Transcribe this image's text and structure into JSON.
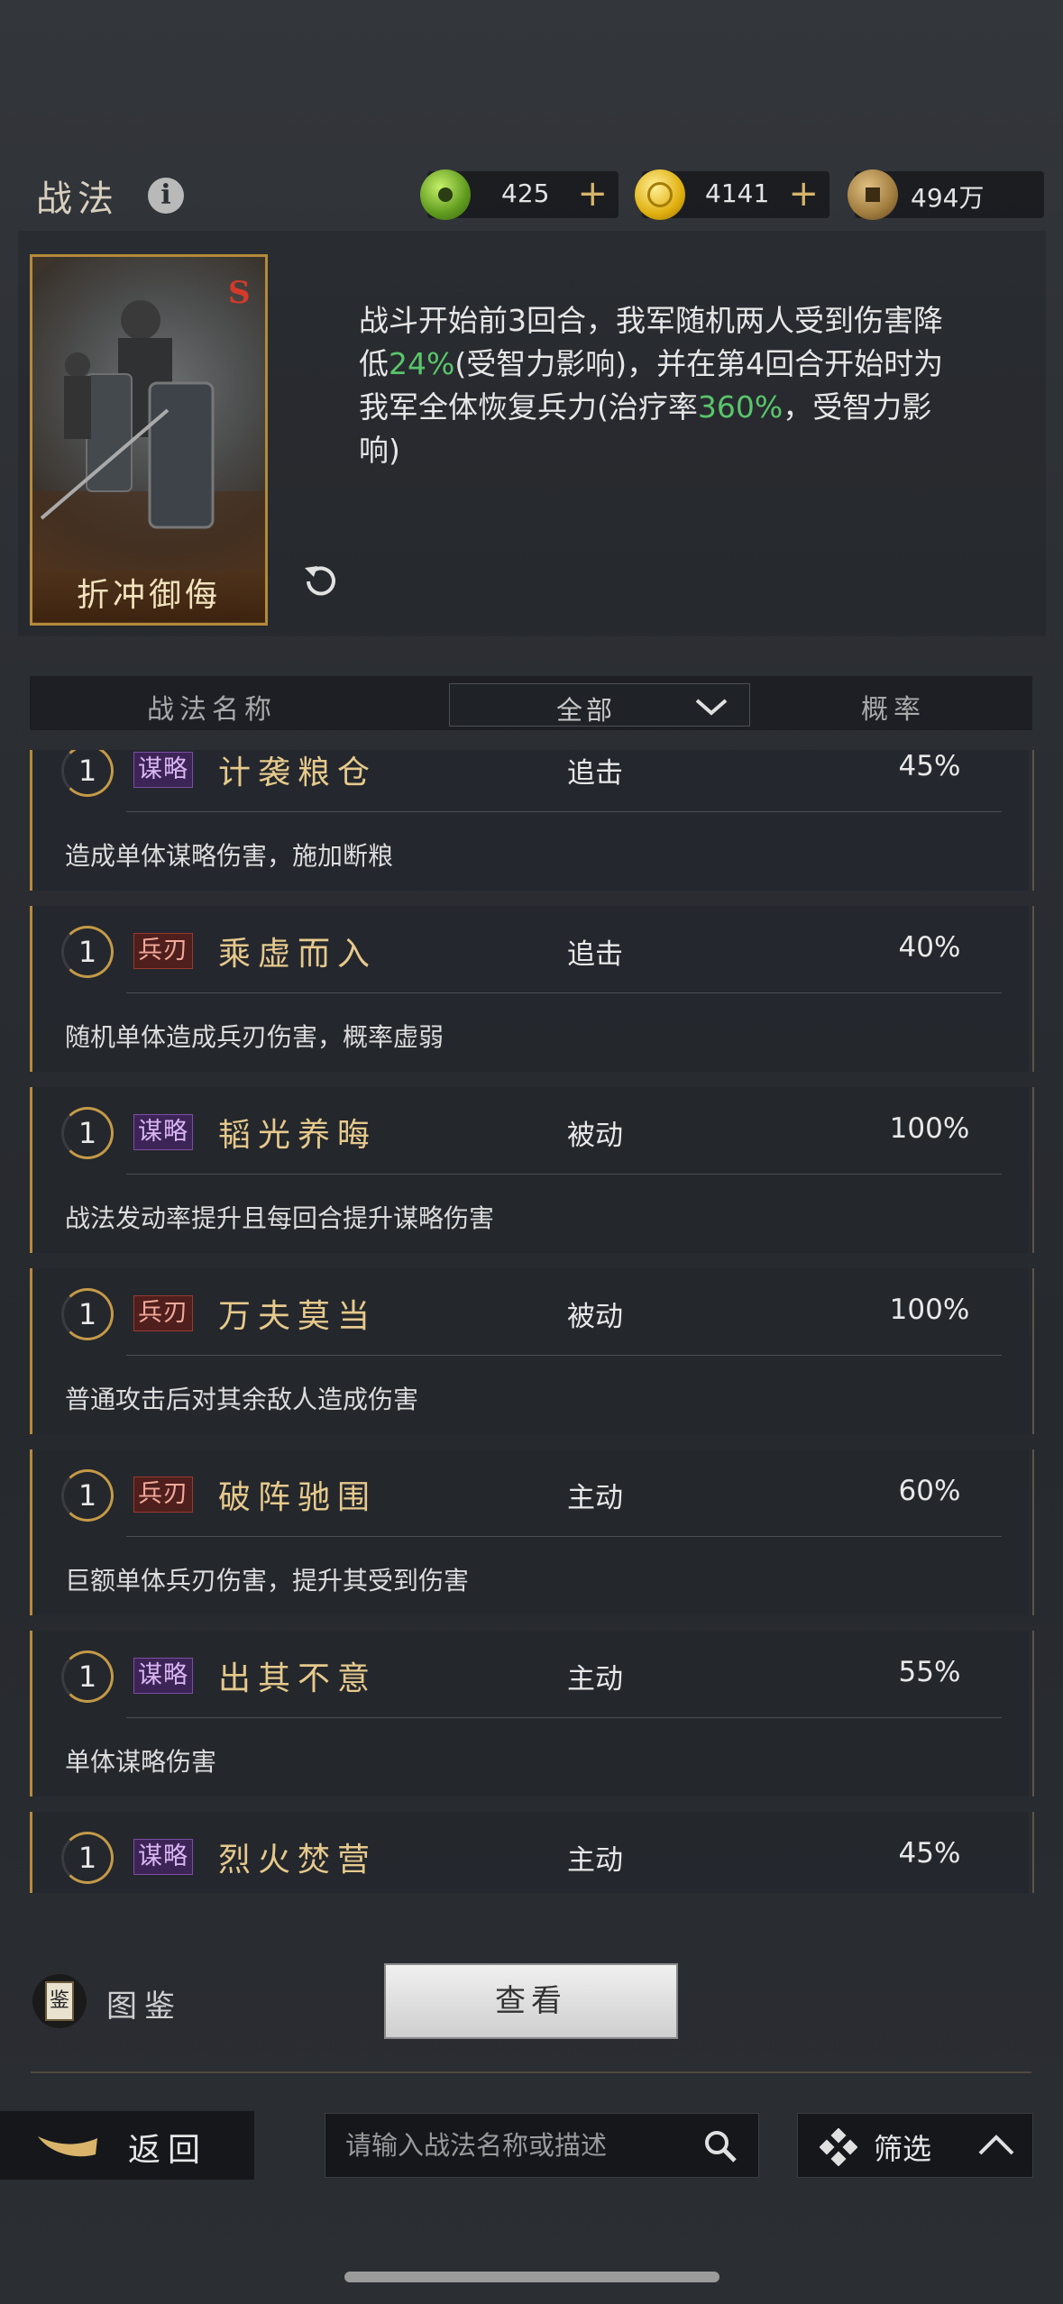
{
  "header": {
    "title": "战法",
    "info_icon": "info-icon",
    "resources": [
      {
        "name": "jade",
        "value": "425",
        "has_plus": true,
        "color": "#7dbf3a"
      },
      {
        "name": "gold",
        "value": "4141",
        "has_plus": true,
        "color": "#e2b520"
      },
      {
        "name": "copper",
        "value": "494万",
        "has_plus": false,
        "color": "#a8874a"
      }
    ]
  },
  "selected_skill": {
    "name": "折冲御侮",
    "badge": "S",
    "description": [
      {
        "t": "战斗开始前3回合，我军随机两人受到伤害降低"
      },
      {
        "t": "24%",
        "hl": true
      },
      {
        "t": "(受智力影响)，并在第4回合开始时为我军全体恢复兵力(治疗率"
      },
      {
        "t": "360%",
        "hl": true
      },
      {
        "t": "，受智力影响)"
      }
    ]
  },
  "table_header": {
    "name_col": "战法名称",
    "filter_value": "全部",
    "prob_col": "概率"
  },
  "skills": [
    {
      "level": "1",
      "tag": "谋略",
      "tag_kind": "mou",
      "name": "计袭粮仓",
      "type": "追击",
      "prob": "45%",
      "effect": "造成单体谋略伤害，施加断粮"
    },
    {
      "level": "1",
      "tag": "兵刃",
      "tag_kind": "bing",
      "name": "乘虚而入",
      "type": "追击",
      "prob": "40%",
      "effect": "随机单体造成兵刃伤害，概率虚弱"
    },
    {
      "level": "1",
      "tag": "谋略",
      "tag_kind": "mou",
      "name": "韬光养晦",
      "type": "被动",
      "prob": "100%",
      "effect": "战法发动率提升且每回合提升谋略伤害"
    },
    {
      "level": "1",
      "tag": "兵刃",
      "tag_kind": "bing",
      "name": "万夫莫当",
      "type": "被动",
      "prob": "100%",
      "effect": "普通攻击后对其余敌人造成伤害"
    },
    {
      "level": "1",
      "tag": "兵刃",
      "tag_kind": "bing",
      "name": "破阵驰围",
      "type": "主动",
      "prob": "60%",
      "effect": "巨额单体兵刃伤害，提升其受到伤害"
    },
    {
      "level": "1",
      "tag": "谋略",
      "tag_kind": "mou",
      "name": "出其不意",
      "type": "主动",
      "prob": "55%",
      "effect": "单体谋略伤害"
    },
    {
      "level": "1",
      "tag": "谋略",
      "tag_kind": "mou",
      "name": "烈火焚营",
      "type": "主动",
      "prob": "45%",
      "effect": ""
    }
  ],
  "bottom": {
    "codex_label": "图鉴",
    "codex_icon_text": "鉴",
    "view_label": "查看",
    "back_label": "返回",
    "search_placeholder": "请输入战法名称或描述",
    "filter_label": "筛选"
  }
}
